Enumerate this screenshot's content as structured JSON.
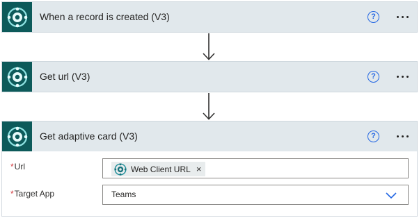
{
  "steps": [
    {
      "title": "When a record is created (V3)",
      "icon": "business-central-logo-icon"
    },
    {
      "title": "Get url (V3)",
      "icon": "business-central-logo-icon"
    },
    {
      "title": "Get adaptive card (V3)",
      "icon": "business-central-logo-icon"
    }
  ],
  "help_symbol": "?",
  "fields": {
    "url": {
      "required_mark": "*",
      "label": "Url",
      "token_label": "Web Client URL",
      "token_remove": "×"
    },
    "target_app": {
      "required_mark": "*",
      "label": "Target App",
      "value": "Teams"
    }
  },
  "colors": {
    "header_bg": "#e1e8ec",
    "icon_bg": "#0d5a5a",
    "accent": "#2266e3",
    "required": "#d13438"
  }
}
